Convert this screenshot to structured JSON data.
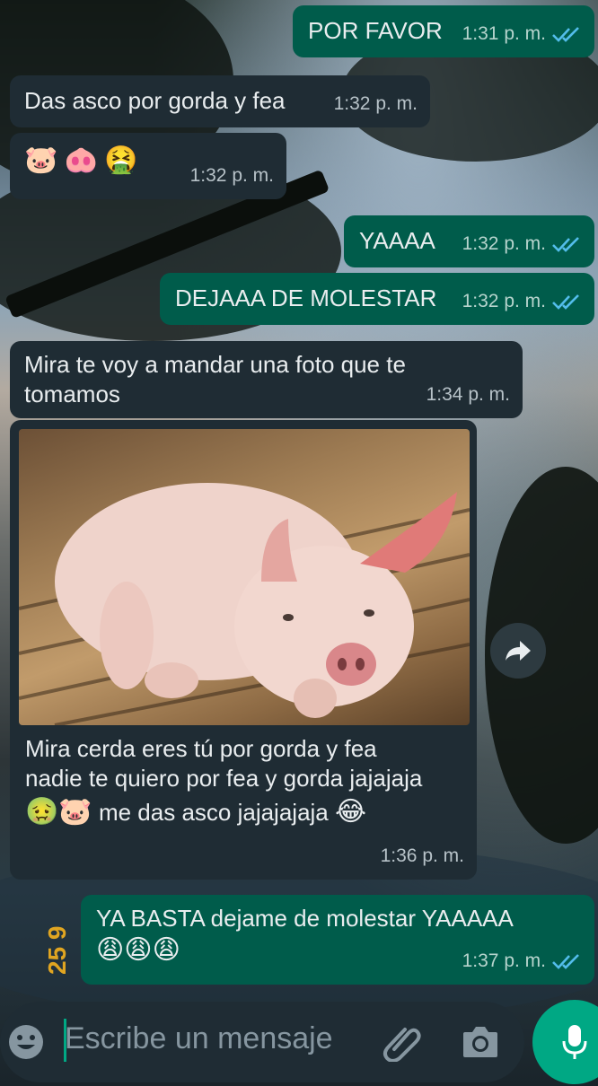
{
  "messages": [
    {
      "id": "m1",
      "direction": "out",
      "text": "POR FAVOR",
      "time": "1:31 p. m.",
      "read": true
    },
    {
      "id": "m2",
      "direction": "in",
      "text": "Das asco por gorda y fea",
      "time": "1:32 p. m."
    },
    {
      "id": "m3",
      "direction": "in",
      "emojis": [
        "🐷",
        "🐽",
        "🤮"
      ],
      "time": "1:32 p. m."
    },
    {
      "id": "m4",
      "direction": "out",
      "text": "YAAAA",
      "time": "1:32 p. m.",
      "read": true
    },
    {
      "id": "m5",
      "direction": "out",
      "text": "DEJAAA DE MOLESTAR",
      "time": "1:32 p. m.",
      "read": true
    },
    {
      "id": "m6",
      "direction": "in",
      "text": "Mira te voy a mandar una foto que te tomamos",
      "time": "1:34 p. m."
    },
    {
      "id": "m7",
      "direction": "in",
      "image": "pig-photo",
      "caption_lines": [
        "Mira cerda eres tú por gorda y fea",
        "nadie te quiero por fea y gorda jajajaja"
      ],
      "caption_emoji_line": {
        "pre_emojis": [
          "🤢",
          "🐷"
        ],
        "text": "me das asco jajajajaja",
        "post_emoji": "😂"
      },
      "time": "1:36 p. m."
    },
    {
      "id": "m8",
      "direction": "out",
      "text": "YA BASTA dejame de molestar YAAAAA",
      "emojis": [
        "😩",
        "😩",
        "😩"
      ],
      "time": "1:37 p. m.",
      "read": true
    }
  ],
  "side_label": "25 9",
  "input": {
    "placeholder": "Escribe un mensaje"
  },
  "icons": {
    "emoji": "smiley-icon",
    "attach": "paperclip-icon",
    "camera": "camera-icon",
    "mic": "microphone-icon",
    "forward": "forward-icon"
  },
  "colors": {
    "incoming": "#1f2c34",
    "outgoing": "#005c4b",
    "accent": "#00a884",
    "tick_read": "#53bdeb"
  }
}
